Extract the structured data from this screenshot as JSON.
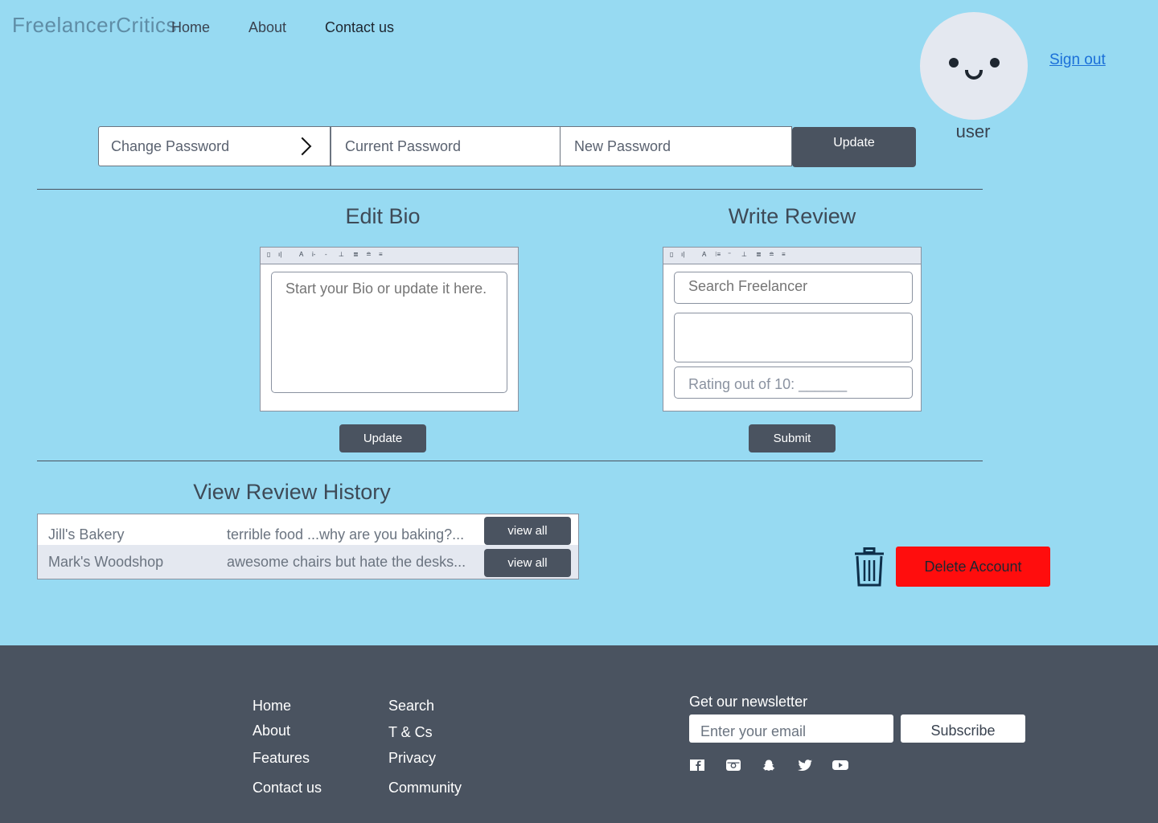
{
  "header": {
    "brand": "FreelancerCritics",
    "nav": [
      "Home",
      "About",
      "Contact us"
    ],
    "username": "user",
    "sign_out": "Sign out"
  },
  "password": {
    "change_label": "Change Password",
    "current_placeholder": "Current Password",
    "new_placeholder": "New Password",
    "update_label": "Update"
  },
  "bio": {
    "title": "Edit Bio",
    "placeholder": "Start your Bio or update it here.",
    "update_label": "Update"
  },
  "review": {
    "title": "Write Review",
    "search_placeholder": "Search Freelancer",
    "rating_label": "Rating out of 10: ______",
    "submit_label": "Submit"
  },
  "history": {
    "title": "View Review History",
    "rows": [
      {
        "name": "Jill's Bakery",
        "snippet": "terrible food ...why are you baking?...",
        "action": "view all"
      },
      {
        "name": "Mark's Woodshop",
        "snippet": "awesome chairs but hate the desks...",
        "action": "view all"
      }
    ]
  },
  "account": {
    "delete_label": "Delete Account"
  },
  "footer": {
    "col1": [
      "Home",
      "About",
      "Features",
      "Contact us"
    ],
    "col2": [
      "Search",
      "T & Cs",
      "Privacy",
      "Community"
    ],
    "newsletter_title": "Get our newsletter",
    "email_placeholder": "Enter your email",
    "subscribe_label": "Subscribe",
    "social_icons": [
      "facebook-icon",
      "instagram-icon",
      "snapchat-icon",
      "twitter-icon",
      "youtube-icon"
    ]
  },
  "colors": {
    "background": "#97daf2",
    "dark": "#4a5360",
    "danger": "#ff0d0d",
    "link": "#1a6fd8"
  }
}
